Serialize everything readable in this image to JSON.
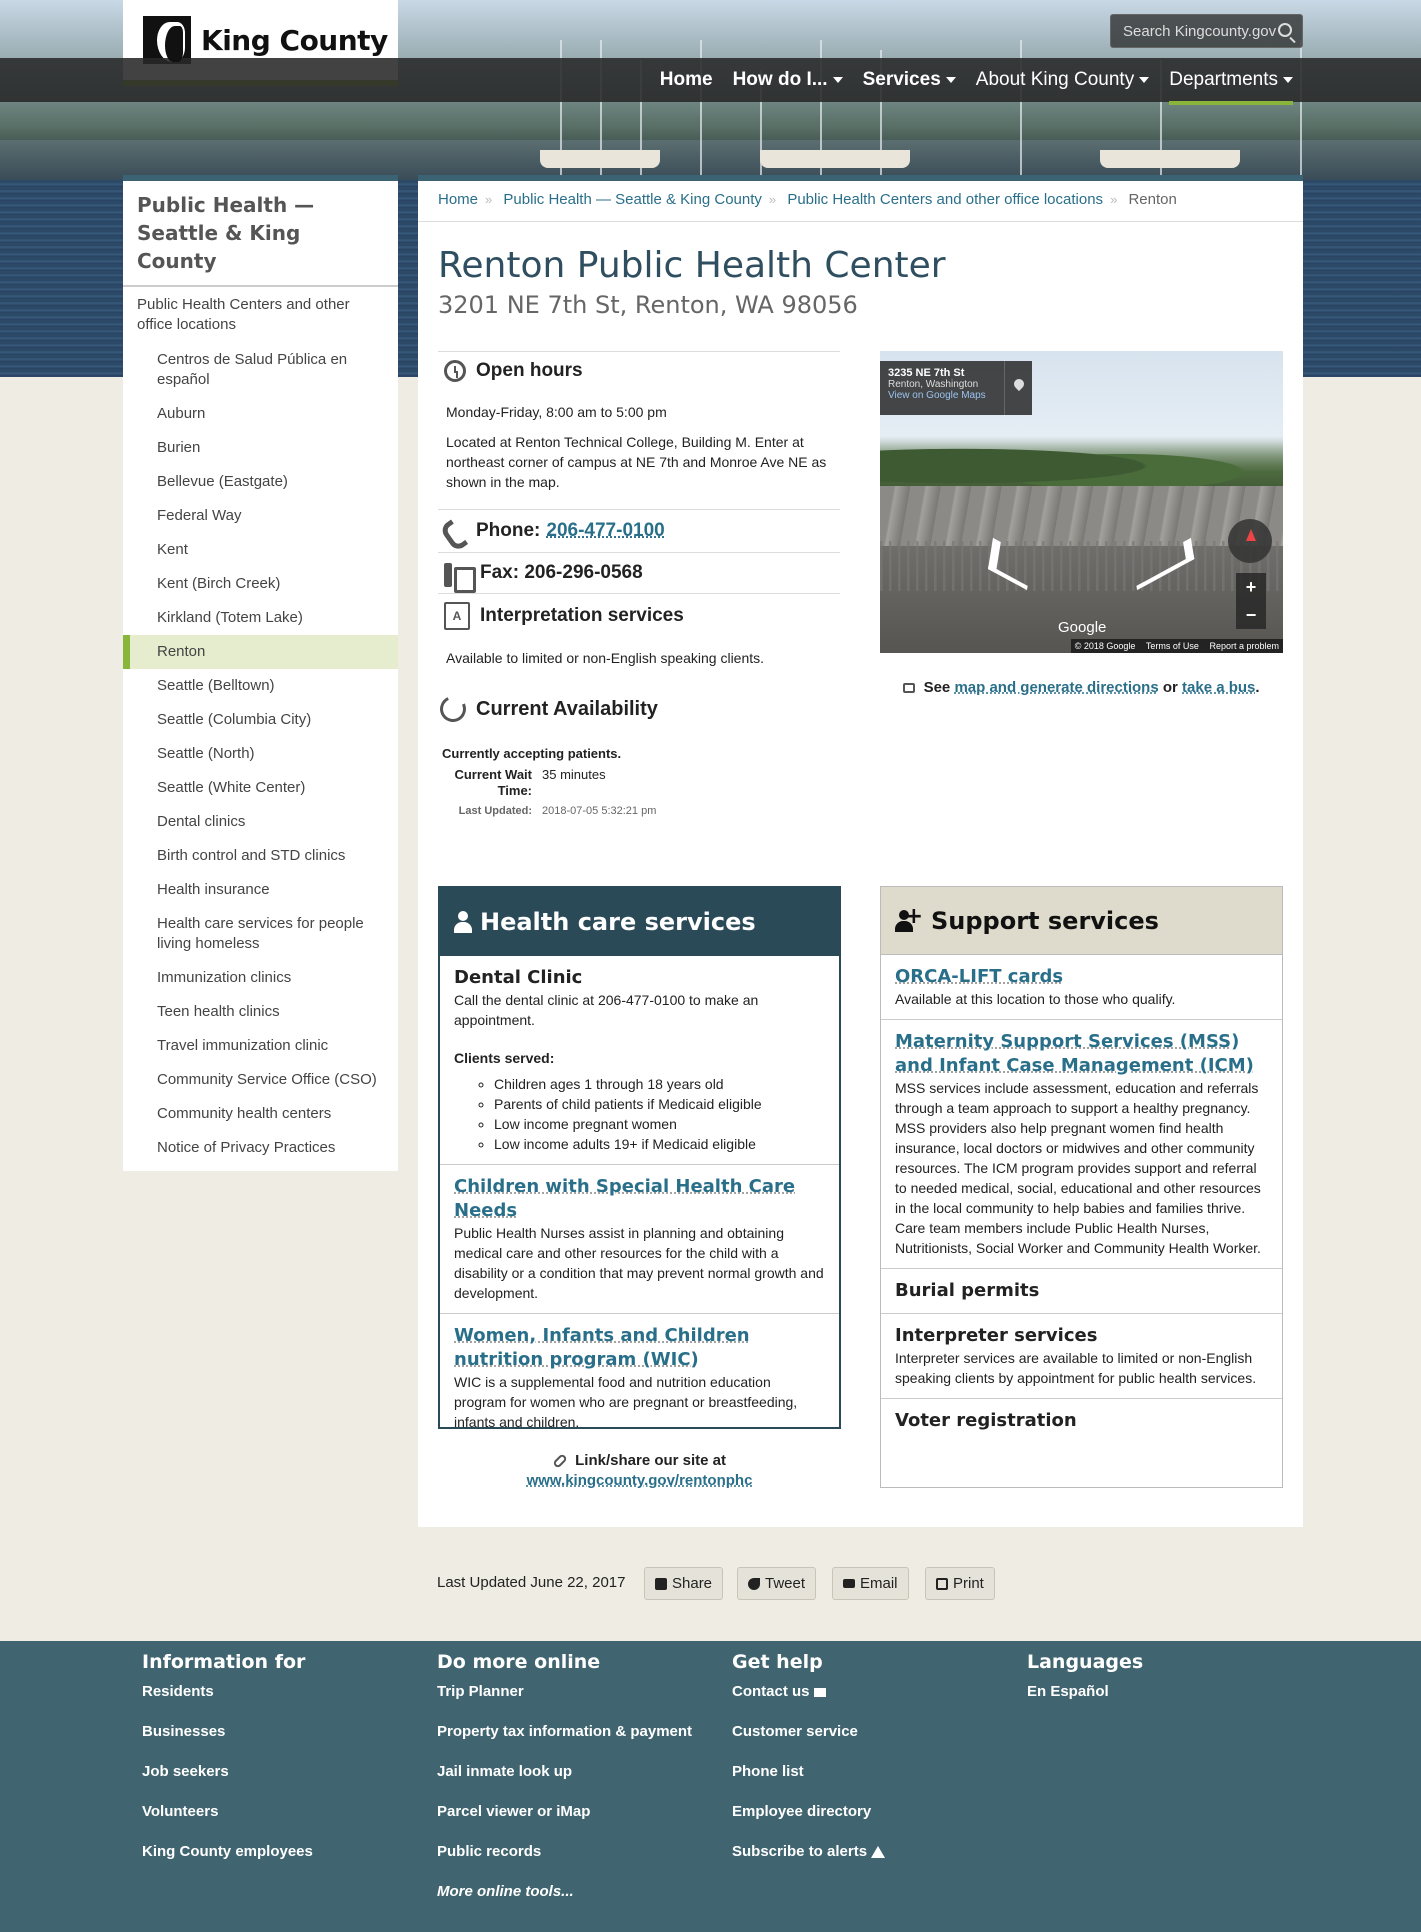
{
  "header": {
    "logo_text": "King County",
    "search_placeholder": "Search Kingcounty.gov",
    "nav": [
      {
        "label": "Home",
        "dropdown": false
      },
      {
        "label": "How do I...",
        "dropdown": true
      },
      {
        "label": "Services",
        "dropdown": true
      },
      {
        "label": "About King County",
        "dropdown": true
      },
      {
        "label": "Departments",
        "dropdown": true,
        "active": true
      }
    ]
  },
  "sidebar": {
    "title": "Public Health — Seattle & King County",
    "parent": "Public Health Centers and other office locations",
    "items": [
      "Centros de Salud Pública en español",
      "Auburn",
      "Burien",
      "Bellevue (Eastgate)",
      "Federal Way",
      "Kent",
      "Kent (Birch Creek)",
      "Kirkland (Totem Lake)",
      "Renton",
      "Seattle (Belltown)",
      "Seattle (Columbia City)",
      "Seattle (North)",
      "Seattle (White Center)",
      "Dental clinics",
      "Birth control and STD clinics",
      "Health insurance",
      "Health care services for people living homeless",
      "Immunization clinics",
      "Teen health clinics",
      "Travel immunization clinic",
      "Community Service Office (CSO)",
      "Community health centers",
      "Notice of Privacy Practices"
    ],
    "active_item": "Renton"
  },
  "breadcrumb": [
    "Home",
    "Public Health — Seattle & King County",
    "Public Health Centers and other office locations",
    "Renton"
  ],
  "page": {
    "title": "Renton Public Health Center",
    "address": "3201 NE 7th St, Renton, WA 98056"
  },
  "info": {
    "hours_title": "Open hours",
    "hours": "Monday-Friday, 8:00 am to 5:00 pm",
    "location_note": "Located at Renton Technical College, Building M. Enter at northeast corner of campus at NE 7th and Monroe Ave NE as shown in the map.",
    "phone_label": "Phone:",
    "phone": "206-477-0100",
    "fax_label": "Fax: 206-296-0568",
    "interp_title": "Interpretation services",
    "interp_text": "Available to limited or non-English speaking clients.",
    "availability_title": "Current Availability",
    "accepting": "Currently accepting patients.",
    "wait_label": "Current Wait Time:",
    "wait_value": "35 minutes",
    "updated_label": "Last Updated:",
    "updated_value": "2018-07-05 5:32:21 pm"
  },
  "map": {
    "address": "3235 NE 7th St",
    "city": "Renton, Washington",
    "link": "View on Google Maps",
    "google": "Google",
    "copyright": "© 2018 Google",
    "terms": "Terms of Use",
    "report": "Report a problem",
    "zoom_in": "+",
    "zoom_out": "−"
  },
  "see": {
    "prefix": "See",
    "link1": "map and generate directions",
    "mid": "or",
    "link2": "take a bus",
    "suffix": "."
  },
  "health_services": {
    "title": "Health care services",
    "items": [
      {
        "title": "Dental Clinic",
        "text": "Call the dental clinic at 206-477-0100 to make an appointment.",
        "clients_label": "Clients served:",
        "clients": [
          "Children ages 1 through 18 years old",
          "Parents of child patients if Medicaid eligible",
          "Low income pregnant women",
          "Low income adults 19+ if Medicaid eligible"
        ]
      },
      {
        "title": "Children with Special Health Care Needs",
        "text": "Public Health Nurses assist in planning and obtaining medical care and other resources for the child with a disability or a condition that may prevent normal growth and development."
      },
      {
        "title": "Women, Infants and Children nutrition program (WIC)",
        "text": "WIC is a supplemental food and nutrition education program for women who are pregnant or breastfeeding, infants and children."
      }
    ]
  },
  "support_services": {
    "title": "Support services",
    "items": [
      {
        "title": "ORCA-LIFT cards",
        "text": "Available at this location to those who qualify."
      },
      {
        "title": "Maternity Support Services (MSS) and Infant Case Management (ICM)",
        "text": "MSS services include assessment, education and referrals through a team approach to support a healthy pregnancy. MSS providers also help pregnant women find health insurance, local doctors or midwives and other community resources. The ICM program provides support and referral to needed medical, social, educational and other resources in the local community to help babies and families thrive. Care team members include Public Health Nurses, Nutritionists, Social Worker and Community Health Worker."
      },
      {
        "title": "Burial permits",
        "text": ""
      },
      {
        "title": "Interpreter services",
        "text": "Interpreter services are available to limited or non-English speaking clients by appointment for public health services."
      },
      {
        "title": "Voter registration",
        "text": ""
      }
    ]
  },
  "share": {
    "label": "Link/share our site at",
    "url": "www.kingcounty.gov/rentonphc"
  },
  "actions": {
    "last_updated": "Last Updated June 22, 2017",
    "share": "Share",
    "tweet": "Tweet",
    "email": "Email",
    "print": "Print"
  },
  "footer": {
    "columns": [
      {
        "title": "Information for",
        "links": [
          "Residents",
          "Businesses",
          "Job seekers",
          "Volunteers",
          "King County employees"
        ]
      },
      {
        "title": "Do more online",
        "links": [
          "Trip Planner",
          "Property tax information & payment",
          "Jail inmate look up",
          "Parcel viewer or iMap",
          "Public records",
          "More online tools..."
        ]
      },
      {
        "title": "Get help",
        "links": [
          "Contact us",
          "Customer service",
          "Phone list",
          "Employee directory",
          "Subscribe to alerts"
        ]
      },
      {
        "title": "Languages",
        "links": [
          "En Español"
        ]
      }
    ]
  },
  "colors": {
    "accent_green": "#8ab53b",
    "header_teal": "#2b4a58",
    "footer_teal": "#416570",
    "link": "#2a6f8a"
  }
}
